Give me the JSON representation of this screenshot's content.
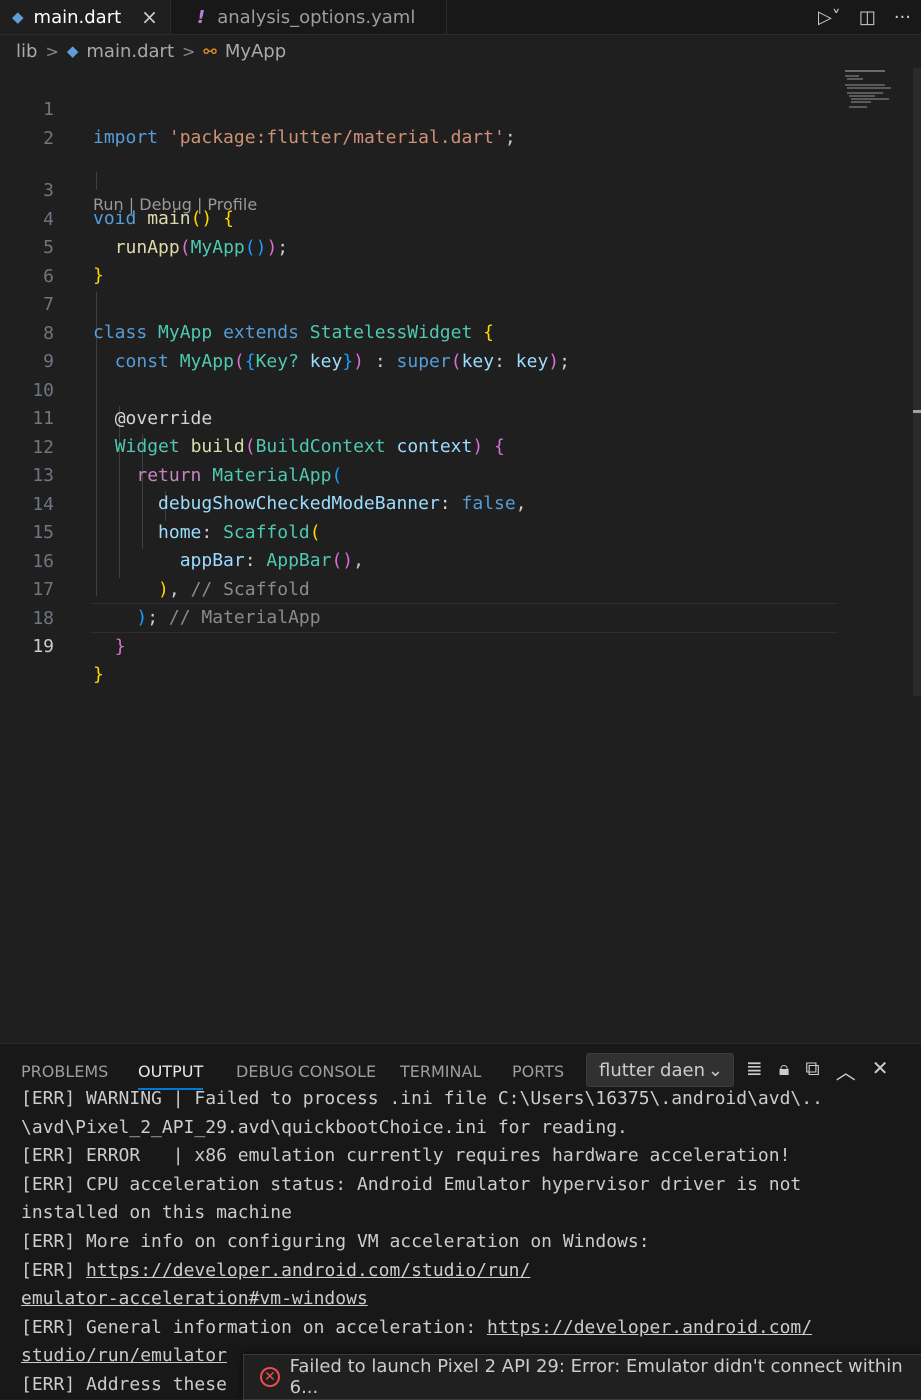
{
  "tabs": [
    {
      "label": "main.dart",
      "active": true,
      "icon": "dart-icon"
    },
    {
      "label": "analysis_options.yaml",
      "active": false,
      "icon": "warning-icon"
    }
  ],
  "breadcrumb": [
    "lib",
    "main.dart",
    "MyApp"
  ],
  "codelens": "Run | Debug | Profile",
  "line_numbers": [
    "1",
    "2",
    "3",
    "4",
    "5",
    "6",
    "7",
    "8",
    "9",
    "10",
    "11",
    "12",
    "13",
    "14",
    "15",
    "16",
    "17",
    "18",
    "19"
  ],
  "code": {
    "l1": {
      "kw": "import",
      "str": "'package:flutter/material.dart'",
      "end": ";"
    },
    "l3": {
      "kw": "void",
      "fn": "main",
      "p1": "(",
      "p2": ")",
      "sp": " ",
      "b": "{"
    },
    "l4": {
      "fn": "runApp",
      "p1": "(",
      "ty": "MyApp",
      "p2": "()",
      "p3": ")",
      "end": ";"
    },
    "l5": {
      "b": "}"
    },
    "l7": {
      "kw1": "class",
      "ty1": "MyApp",
      "kw2": "extends",
      "ty2": "StatelessWidget",
      "b": "{"
    },
    "l8": {
      "kw": "const",
      "ty1": "MyApp",
      "p1": "(",
      "p2": "{",
      "ty2": "Key?",
      "var1": "key",
      "p3": "}",
      "p4": ")",
      "op": ":",
      "kw2": "super",
      "p5": "(",
      "var2": "key",
      "colon": ":",
      "var3": "key",
      "p6": ")",
      "end": ";"
    },
    "l10": {
      "txt": "@override"
    },
    "l11": {
      "ty1": "Widget",
      "fn": "build",
      "p1": "(",
      "ty2": "BuildContext",
      "var": "context",
      "p2": ")",
      "b": "{"
    },
    "l12": {
      "ctl": "return",
      "ty": "MaterialApp",
      "p": "("
    },
    "l13": {
      "var": "debugShowCheckedModeBanner",
      "colon": ":",
      "kw": "false",
      "end": ","
    },
    "l14": {
      "var": "home",
      "colon": ":",
      "ty": "Scaffold",
      "p": "("
    },
    "l15": {
      "var": "appBar",
      "colon": ":",
      "ty": "AppBar",
      "p": "()",
      "end": ","
    },
    "l16": {
      "p": ")",
      "end": ",",
      "cm": "// Scaffold"
    },
    "l17": {
      "p": ")",
      "end": ";",
      "cm": "// MaterialApp"
    },
    "l18": {
      "b": "}"
    },
    "l19": {
      "b": "}"
    }
  },
  "panel": {
    "tabs": [
      "PROBLEMS",
      "OUTPUT",
      "DEBUG CONSOLE",
      "TERMINAL",
      "PORTS"
    ],
    "active_tab": "OUTPUT",
    "channel": "flutter daen",
    "output_lines": [
      "[ERR] WARNING | Failed to process .ini file C:\\Users\\16375\\.android\\avd\\..",
      "\\avd\\Pixel_2_API_29.avd\\quickbootChoice.ini for reading.",
      "[ERR] ERROR   | x86 emulation currently requires hardware acceleration!",
      "[ERR] CPU acceleration status: Android Emulator hypervisor driver is not",
      "installed on this machine",
      "[ERR] More info on configuring VM acceleration on Windows:"
    ],
    "link_lines": {
      "l7_prefix": "[ERR] ",
      "l7_link": "https://developer.android.com/studio/run/",
      "l8_link": "emulator-acceleration#vm-windows",
      "l9_prefix": "[ERR] General information on acceleration: ",
      "l9_link": "https://developer.android.com/",
      "l10_link": "studio/run/emulator",
      "l11_text": "[ERR] Address these"
    }
  },
  "toast": {
    "message": "Failed to launch Pixel 2 API 29: Error: Emulator didn't connect within 6..."
  }
}
